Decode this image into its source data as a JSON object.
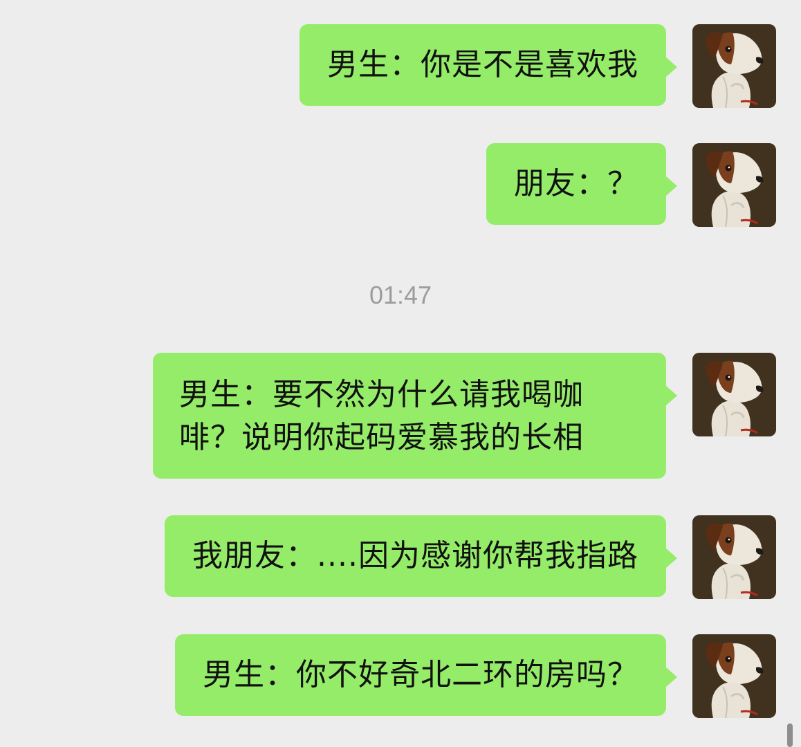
{
  "chat": {
    "time_divider": "01:47",
    "messages": [
      {
        "text": "男生：你是不是喜欢我"
      },
      {
        "text": "朋友：？"
      },
      {
        "text": "男生：要不然为什么请我喝咖啡？说明你起码爱慕我的长相"
      },
      {
        "text": "我朋友：....因为感谢你帮我指路"
      },
      {
        "text": "男生：你不好奇北二环的房吗？"
      }
    ]
  },
  "colors": {
    "background": "#ededed",
    "bubble_green": "#95ec69",
    "timestamp_gray": "#9c9c9c"
  },
  "icons": {
    "avatar": "dog-portrait-avatar"
  }
}
